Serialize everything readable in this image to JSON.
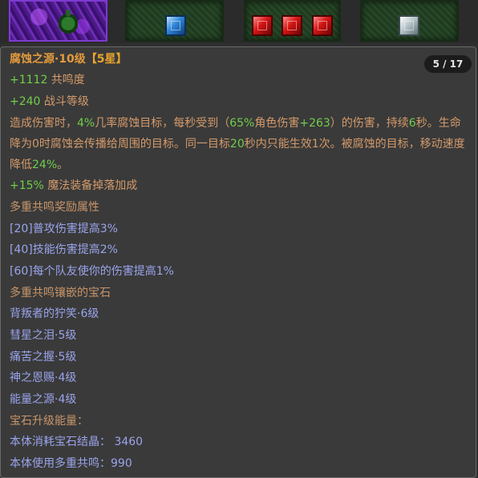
{
  "item": {
    "title": "腐蚀之源·10级",
    "stars": "【5星】",
    "resonance_value": "+1112",
    "resonance_label": "共鸣度",
    "combat_value": "+240",
    "combat_label": "战斗等级",
    "description": {
      "p1": "造成伤害时，",
      "v1": "4%",
      "p2": "几率腐蚀目标，每秒受到（",
      "v2": "65%",
      "p3": "角色伤害",
      "v3": "+263",
      "p4": "）的伤害，持续",
      "v4": "6",
      "p5": "秒。生命降为0时腐蚀会传播给周围的目标。同一目标",
      "v5": "20",
      "p6": "秒内只能生效1次。被腐蚀的目标，移动速度降低",
      "v6": "24%",
      "p7": "。"
    },
    "drop_value": "+15%",
    "drop_label": "魔法装备掉落加成"
  },
  "pager": {
    "text": "5 / 17"
  },
  "bonus": {
    "header": "多重共鸣奖励属性",
    "items": [
      "[20]普攻伤害提高3%",
      "[40]技能伤害提高2%",
      "[60]每个队友使你的伤害提高1%"
    ]
  },
  "gems": {
    "header": "多重共鸣镶嵌的宝石",
    "items": [
      "背叛者的狞笑·6级",
      "彗星之泪·5级",
      "痛苦之握·5级",
      "神之恩赐·4级",
      "能量之源·4级"
    ]
  },
  "upgrade": {
    "header": "宝石升级能量：",
    "crystal_label": "本体消耗宝石结晶：",
    "crystal_value": "3460",
    "resonance_label": "本体使用多重共鸣：",
    "resonance_value": "990"
  },
  "slots": {
    "slot1_icon": "corrosion-source-icon",
    "slot2_gems": [
      "blue"
    ],
    "slot3_gems": [
      "red",
      "red",
      "red"
    ],
    "slot4_gems": [
      "white"
    ]
  }
}
